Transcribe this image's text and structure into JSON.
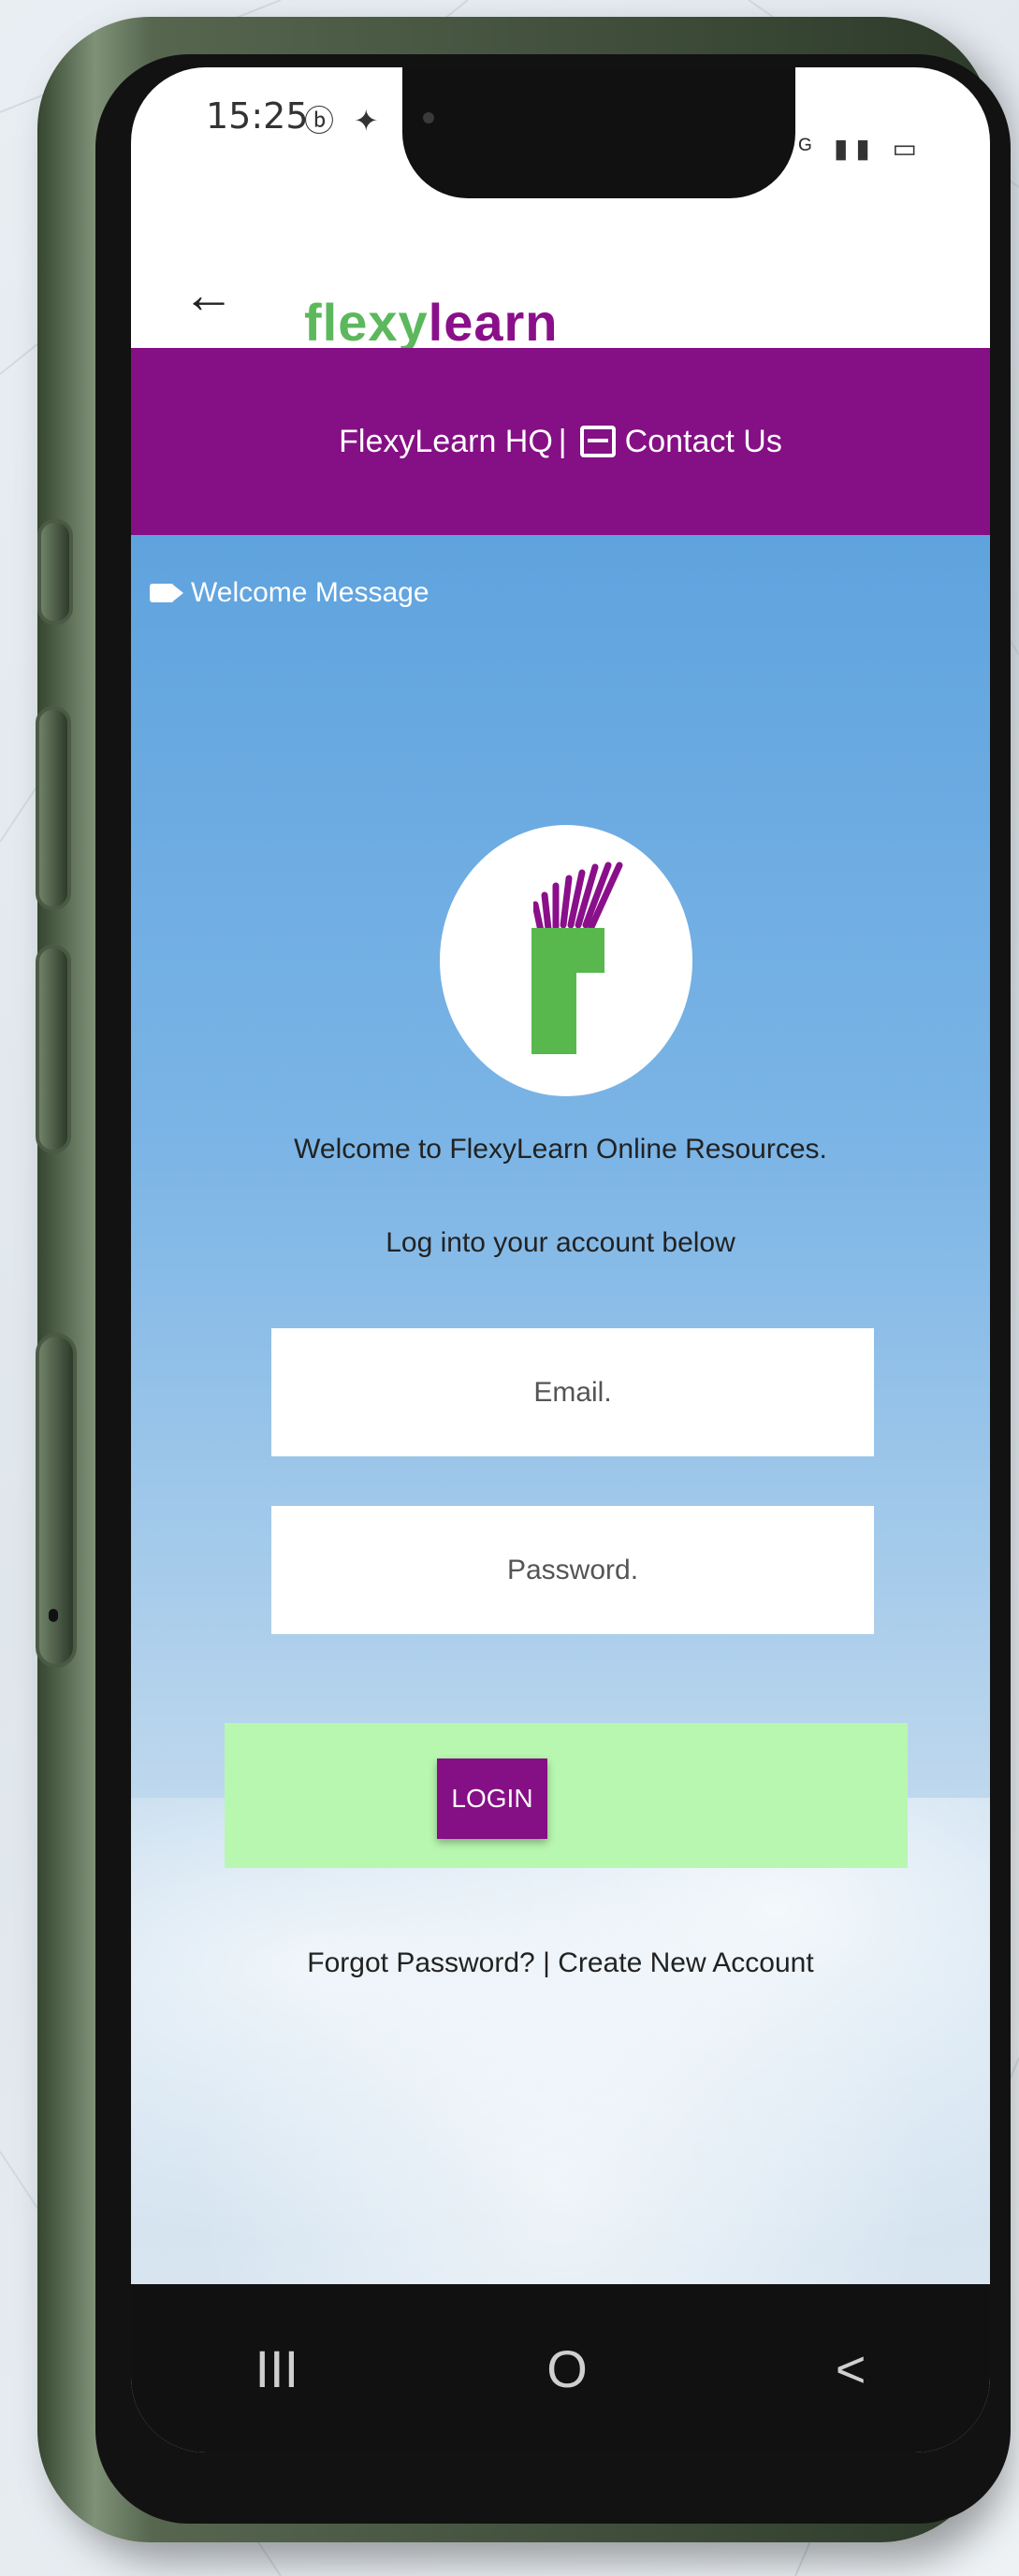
{
  "status": {
    "time": "15:25",
    "left_icons": [
      "data-saver-icon",
      "twitter-icon",
      "grid-icon"
    ],
    "right_icons_text": "⏰ ¶ ⁴ᴳ ▮▮ ▭"
  },
  "header": {
    "brand_left": "flexy",
    "brand_right": "learn"
  },
  "purple_bar": {
    "hq_label": "FlexyLearn HQ",
    "separator": "|",
    "contact_label": "Contact Us"
  },
  "welcome_message": "Welcome Message",
  "welcome_line1": "Welcome to FlexyLearn Online Resources.",
  "welcome_line2": "Log into your account below",
  "form": {
    "email_placeholder": "Email.",
    "password_placeholder": "Password.",
    "login_label": "LOGIN"
  },
  "footer": {
    "forgot": "Forgot Password?",
    "separator": "|",
    "create": "Create New Account"
  },
  "nav": {
    "recent": "III",
    "home": "O",
    "back": "<"
  },
  "colors": {
    "purple": "#850f85",
    "green": "#58b84d",
    "login_band": "#b8f7b0"
  }
}
